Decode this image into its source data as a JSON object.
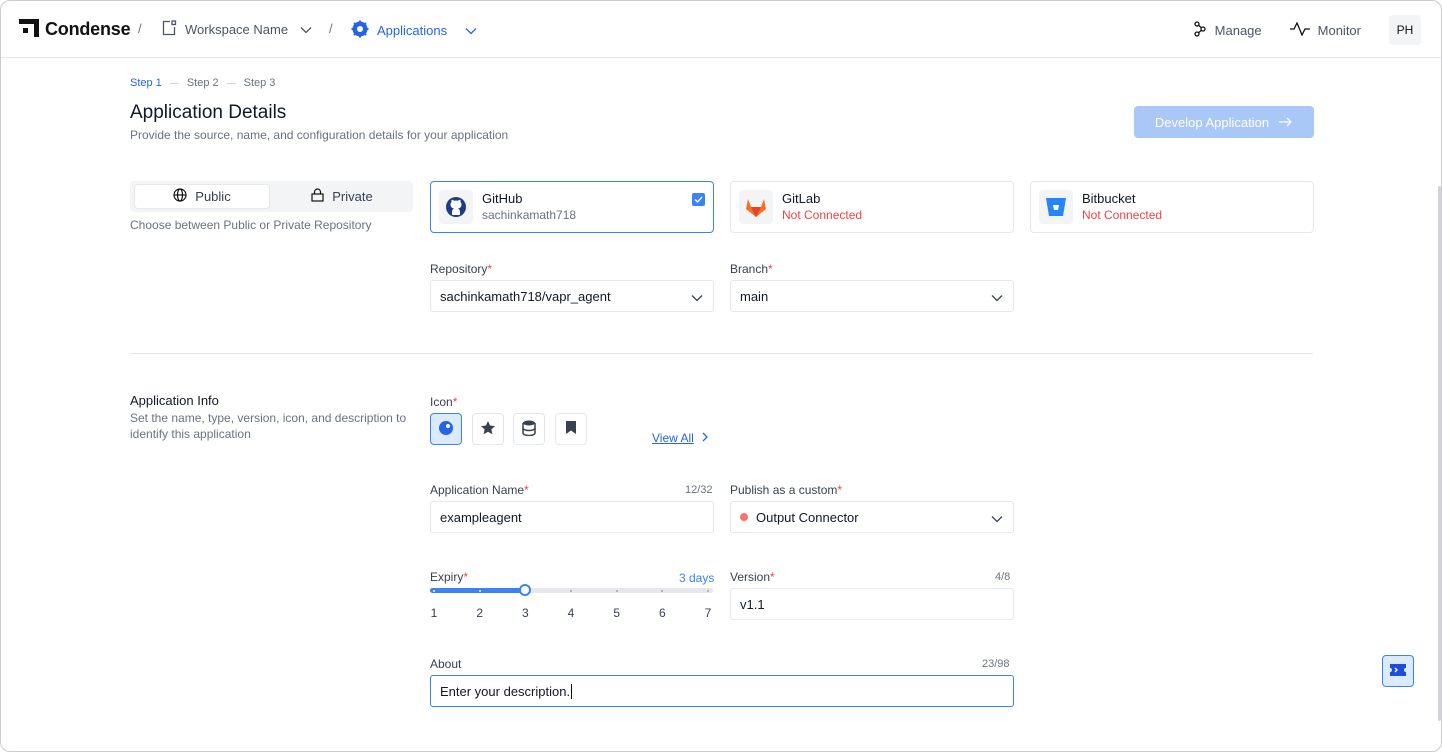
{
  "header": {
    "brand": "Condense",
    "sep": "/",
    "workspace": "Workspace Name",
    "section": "Applications",
    "nav": [
      {
        "label": "Manage",
        "icon": "graph-icon"
      },
      {
        "label": "Monitor",
        "icon": "pulse-icon"
      }
    ],
    "avatar": "PH"
  },
  "steps": [
    "Step 1",
    "Step 2",
    "Step 3"
  ],
  "page": {
    "title": "Application Details",
    "subtitle": "Provide the source, name, and configuration details for your application",
    "develop_button": "Develop Application"
  },
  "source": {
    "visibility": {
      "public": "Public",
      "private": "Private",
      "selected": "Public"
    },
    "hint": "Choose between Public or Private Repository",
    "providers": [
      {
        "name": "GitHub",
        "status": "sachinkamath718",
        "selected": true
      },
      {
        "name": "GitLab",
        "status": "Not Connected",
        "selected": false
      },
      {
        "name": "Bitbucket",
        "status": "Not Connected",
        "selected": false
      }
    ],
    "repository_label": "Repository",
    "repository_value": "sachinkamath718/vapr_agent",
    "branch_label": "Branch",
    "branch_value": "main"
  },
  "app_info": {
    "title": "Application Info",
    "desc": "Set the name, type, version, icon, and description to identify this application",
    "icon_label": "Icon",
    "icons": [
      "blob-icon",
      "star-icon",
      "database-icon",
      "bookmark-icon"
    ],
    "view_all": "View All",
    "name_label": "Application Name",
    "name_counter": "12/32",
    "name_value": "exampleagent",
    "publish_label": "Publish as a custom",
    "publish_value": "Output Connector",
    "expiry_label": "Expiry",
    "expiry_value_text": "3 days",
    "expiry_value": 3,
    "expiry_min": 1,
    "expiry_max": 7,
    "expiry_ticks": [
      "1",
      "2",
      "3",
      "4",
      "5",
      "6",
      "7"
    ],
    "version_label": "Version",
    "version_counter": "4/8",
    "version_value": "v1.1",
    "about_label": "About",
    "about_counter": "23/98",
    "about_value": "Enter your description."
  },
  "colors": {
    "accent": "#3b82f6",
    "error": "#ef4444",
    "disabled_button": "#a9c7f7"
  }
}
